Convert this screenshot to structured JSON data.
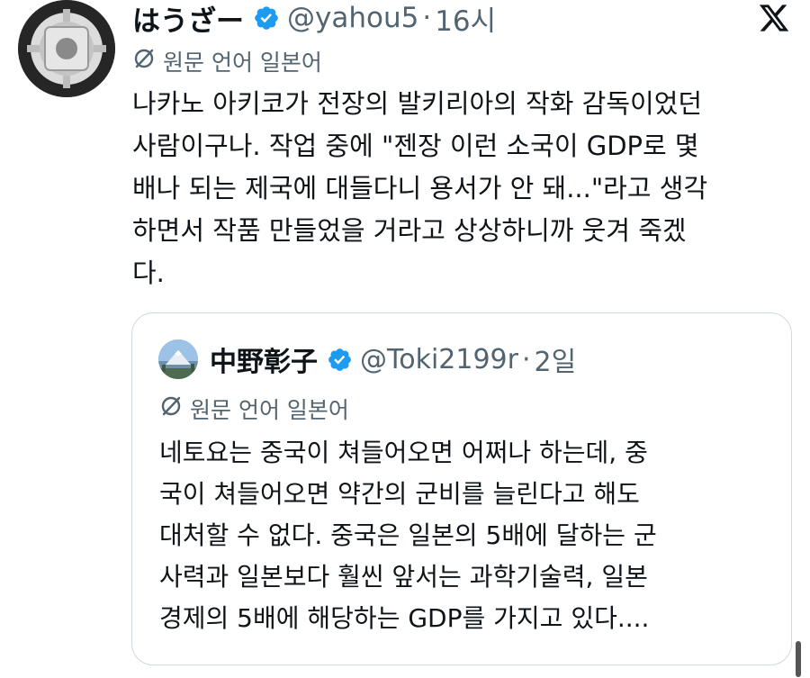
{
  "tweet": {
    "author_name": "はうざー",
    "handle": "@yahou5",
    "time": "16시",
    "translate_label": "원문 언어 일본어",
    "body_lines": [
      "나카노 아키코가 전장의 발키리아의 작화 감독이었던",
      "사람이구나. 작업 중에 \"젠장 이런 소국이 GDP로 몇",
      "배나 되는 제국에 대들다니 용서가 안 돼...\"라고 생각",
      "하면서 작품 만들었을 거라고 상상하니까 웃겨 죽겠",
      "다."
    ]
  },
  "quote": {
    "author_name": "中野彰子",
    "handle": "@Toki2199r",
    "time": "2일",
    "translate_label": "원문 언어 일본어",
    "body_lines": [
      "네토요는 중국이 쳐들어오면 어쩌나 하는데, 중",
      "국이 쳐들어오면 약간의 군비를 늘린다고 해도",
      "대처할 수 없다. 중국은 일본의 5배에 달하는 군",
      "사력과 일본보다 훨씬 앞서는 과학기술력, 일본",
      "경제의 5배에 해당하는 GDP를 가지고 있다...."
    ]
  },
  "icons": {
    "verified": "verified-badge-icon",
    "translate": "translate-icon",
    "x_logo": "x-logo-icon"
  },
  "colors": {
    "text": "#0f1419",
    "muted": "#536471",
    "verified": "#1d9bf0",
    "border": "#cfd9de"
  }
}
